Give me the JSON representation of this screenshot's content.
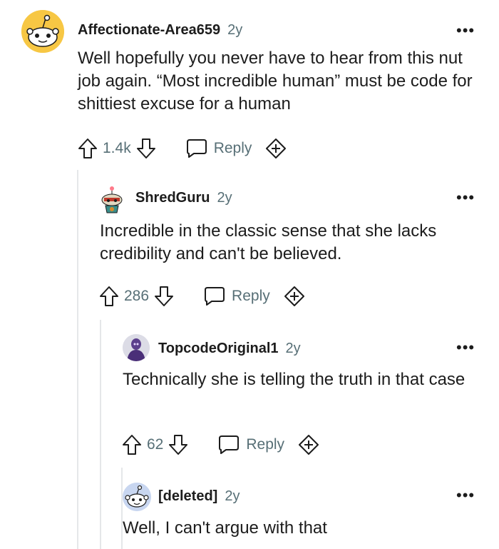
{
  "comments": [
    {
      "author": "Affectionate-Area659",
      "time": "2y",
      "more": "•••",
      "text": "Well hopefully you never have to hear from this nut job again. “Most incredible human” must be code for shittiest excuse for a human",
      "score": "1.4k",
      "reply_label": "Reply"
    },
    {
      "author": "ShredGuru",
      "time": "2y",
      "more": "•••",
      "text": "Incredible in the classic sense that she lacks credibility and can't be believed.",
      "score": "286",
      "reply_label": "Reply"
    },
    {
      "author": "TopcodeOriginal1",
      "time": "2y",
      "more": "•••",
      "text": "Technically she is telling the truth in that case",
      "score": "62",
      "reply_label": "Reply"
    },
    {
      "author": "[deleted]",
      "time": "2y",
      "more": "•••",
      "text": "Well, I can't argue with that"
    }
  ],
  "colors": {
    "meta": "#576f76",
    "text": "#1c1c1c",
    "thread_line": "#e5e7e9",
    "snoo_yellow": "#f7c744"
  },
  "icons": [
    "snoo-avatar-icon",
    "upvote-icon",
    "downvote-icon",
    "comment-bubble-icon",
    "award-plus-icon",
    "more-options-icon"
  ]
}
